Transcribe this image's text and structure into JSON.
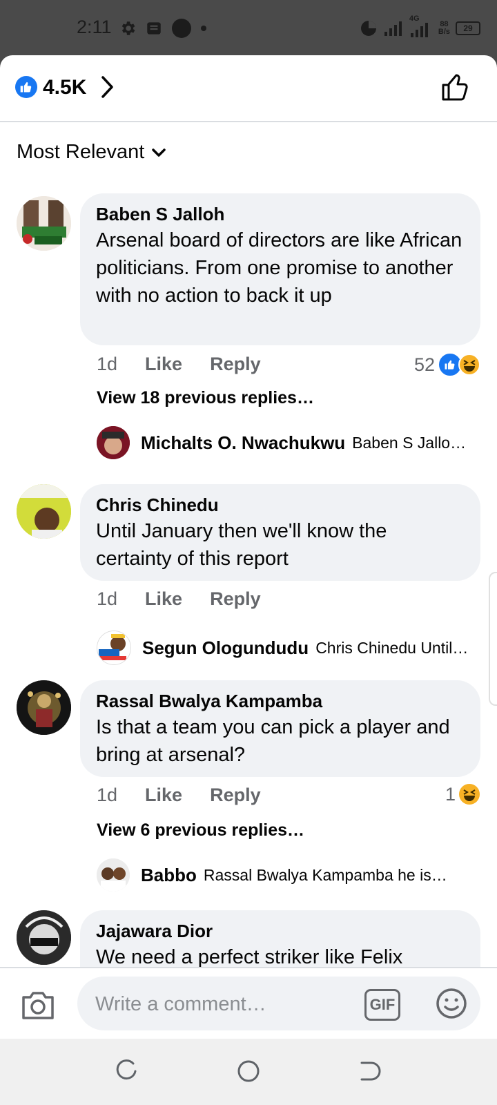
{
  "status_bar": {
    "time": "2:11",
    "network_label": "4G",
    "net_speed_value": "88",
    "net_speed_unit": "B/s",
    "battery": "29"
  },
  "header": {
    "reaction_count": "4.5K",
    "sort_label": "Most Relevant"
  },
  "comments": [
    {
      "author": "Baben S Jalloh",
      "text": "Arsenal board of directors are like African politicians. From one promise to another with no action to back it up",
      "time": "1d",
      "like_label": "Like",
      "reply_label": "Reply",
      "reaction_count": "52",
      "view_replies": "View 18 previous replies…",
      "reply": {
        "author": "Michalts O. Nwachukwu",
        "text": "Baben S Jallo…"
      }
    },
    {
      "author": "Chris Chinedu",
      "text": "Until January then we'll know the certainty of this report",
      "time": "1d",
      "like_label": "Like",
      "reply_label": "Reply",
      "reply": {
        "author": "Segun Ologundudu",
        "text": "Chris Chinedu Until…"
      }
    },
    {
      "author": "Rassal Bwalya Kampamba",
      "text": "Is that a team you can pick a player and bring at arsenal?",
      "time": "1d",
      "like_label": "Like",
      "reply_label": "Reply",
      "reaction_count": "1",
      "view_replies": "View 6 previous replies…",
      "reply": {
        "author": "Babbo",
        "text": "Rassal Bwalya Kampamba he is…"
      }
    },
    {
      "author": "Jajawara Dior",
      "text": "We need a perfect striker like Felix"
    }
  ],
  "composer": {
    "placeholder": "Write a comment…",
    "gif_label": "GIF"
  },
  "colors": {
    "brand_blue": "#1877f2",
    "bubble_bg": "#f0f2f5",
    "secondary_text": "#65676b",
    "haha_yellow": "#f7b125"
  },
  "icons": [
    "settings-gear-icon",
    "message-icon",
    "camera-icon",
    "emoji-icon",
    "like-thumb-icon",
    "chevron-right-icon",
    "chevron-down-icon"
  ]
}
